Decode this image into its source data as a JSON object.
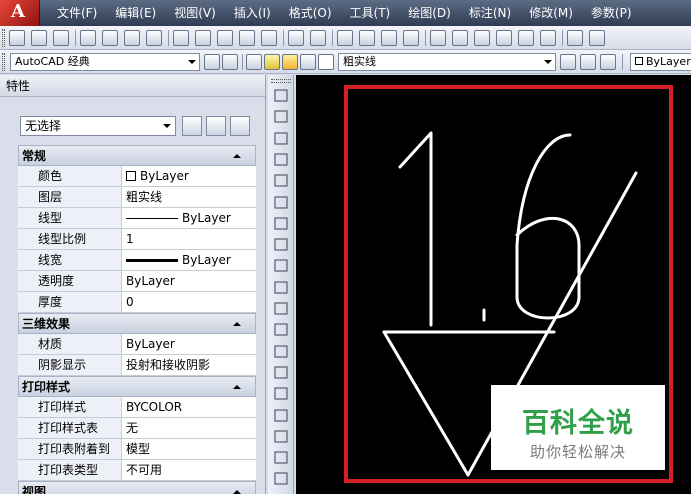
{
  "app": {
    "logo_letter": "A"
  },
  "menu": {
    "items": [
      "文件(F)",
      "编辑(E)",
      "视图(V)",
      "插入(I)",
      "格式(O)",
      "工具(T)",
      "绘图(D)",
      "标注(N)",
      "修改(M)",
      "参数(P)"
    ]
  },
  "toolbar2": {
    "workspace": "AutoCAD 经典",
    "layer": "粗实线",
    "linetype": "ByLayer"
  },
  "properties": {
    "title": "特性",
    "selection": "无选择",
    "sections": [
      {
        "title": "常规",
        "rows": [
          {
            "name": "颜色",
            "value": "ByLayer",
            "decor": "swatch"
          },
          {
            "name": "图层",
            "value": "粗实线"
          },
          {
            "name": "线型",
            "value": "ByLayer",
            "decor": "line"
          },
          {
            "name": "线型比例",
            "value": "1"
          },
          {
            "name": "线宽",
            "value": "ByLayer",
            "decor": "thick"
          },
          {
            "name": "透明度",
            "value": "ByLayer"
          },
          {
            "name": "厚度",
            "value": "0"
          }
        ]
      },
      {
        "title": "三维效果",
        "rows": [
          {
            "name": "材质",
            "value": "ByLayer"
          },
          {
            "name": "阴影显示",
            "value": "投射和接收阴影"
          }
        ]
      },
      {
        "title": "打印样式",
        "rows": [
          {
            "name": "打印样式",
            "value": "BYCOLOR"
          },
          {
            "name": "打印样式表",
            "value": "无"
          },
          {
            "name": "打印表附着到",
            "value": "模型"
          },
          {
            "name": "打印表类型",
            "value": "不可用"
          }
        ]
      },
      {
        "title": "视图",
        "rows": []
      }
    ]
  },
  "drawing": {
    "surface_roughness": "1.6"
  },
  "watermark": {
    "title": "百科全说",
    "subtitle": "助你轻松解决"
  },
  "colors": {
    "highlight_box": "#d41f26",
    "canvas_bg": "#000000",
    "stroke": "#ffffff",
    "watermark_green": "#2f9f4a"
  }
}
